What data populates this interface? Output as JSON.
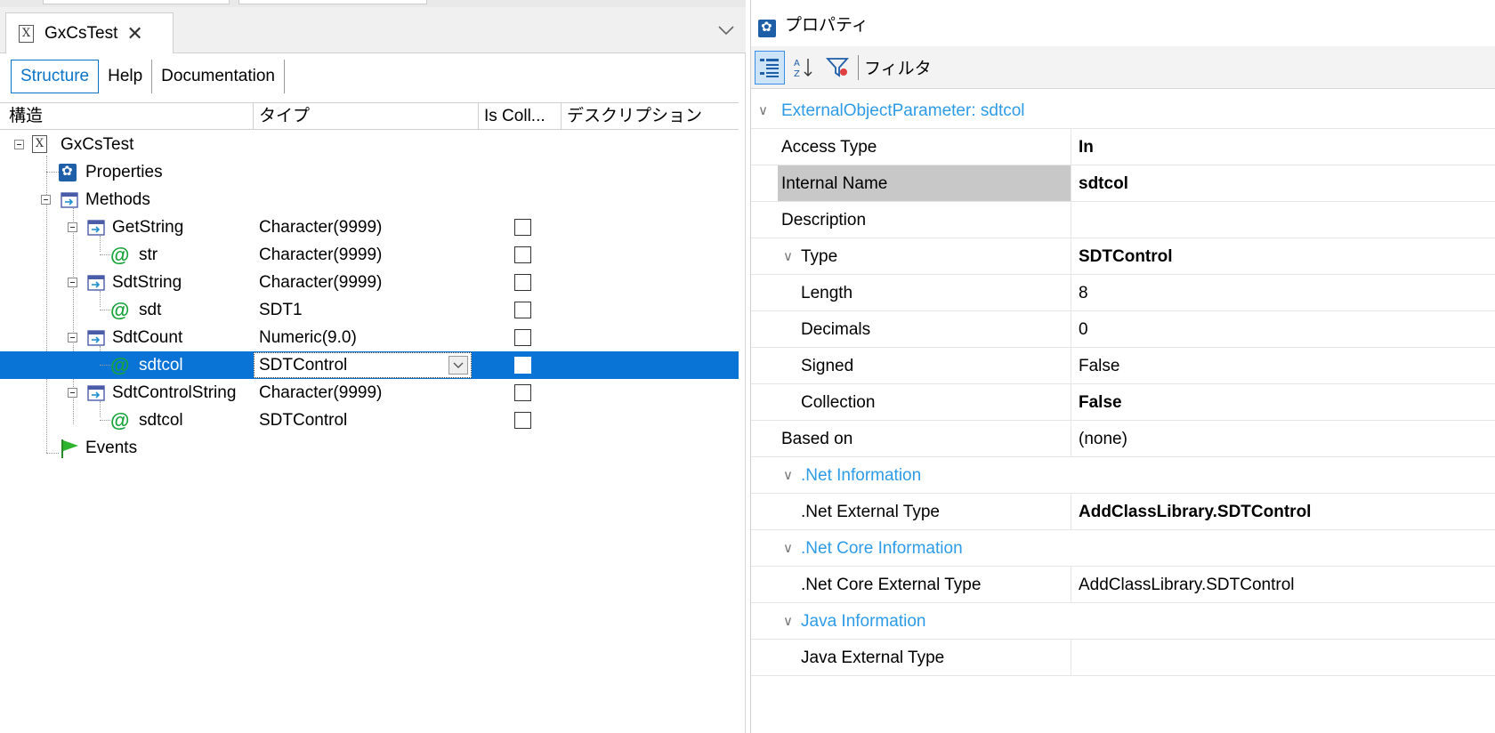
{
  "editor": {
    "tab_title": "GxCsTest",
    "subtabs": [
      "Structure",
      "Help",
      "Documentation"
    ],
    "columns": [
      "構造",
      "タイプ",
      "Is Coll...",
      "デスクリプション"
    ],
    "tree": [
      {
        "name": "GxCsTest",
        "type": "",
        "kind": "root",
        "level": 0
      },
      {
        "name": "Properties",
        "type": "",
        "kind": "properties",
        "level": 1
      },
      {
        "name": "Methods",
        "type": "",
        "kind": "methods",
        "level": 1
      },
      {
        "name": "GetString",
        "type": "Character(9999)",
        "kind": "method",
        "level": 2
      },
      {
        "name": "str",
        "type": "Character(9999)",
        "kind": "param",
        "level": 3
      },
      {
        "name": "SdtString",
        "type": "Character(9999)",
        "kind": "method",
        "level": 2
      },
      {
        "name": "sdt",
        "type": "SDT1",
        "kind": "param",
        "level": 3
      },
      {
        "name": "SdtCount",
        "type": "Numeric(9.0)",
        "kind": "method",
        "level": 2
      },
      {
        "name": "sdtcol",
        "type": "SDTControl",
        "kind": "param",
        "level": 3,
        "selected": true
      },
      {
        "name": "SdtControlString",
        "type": "Character(9999)",
        "kind": "method",
        "level": 2
      },
      {
        "name": "sdtcol",
        "type": "SDTControl",
        "kind": "param",
        "level": 3
      },
      {
        "name": "Events",
        "type": "",
        "kind": "events",
        "level": 1
      }
    ]
  },
  "properties": {
    "title": "プロパティ",
    "filter_label": "フィルタ",
    "rows": [
      {
        "name": "ExternalObjectParameter: sdtcol",
        "value": "",
        "kind": "header"
      },
      {
        "name": "Access Type",
        "value": "In",
        "bold": true,
        "indent": 0
      },
      {
        "name": "Internal Name",
        "value": "sdtcol",
        "bold": true,
        "indent": 0,
        "highlight": true
      },
      {
        "name": "Description",
        "value": "",
        "indent": 0
      },
      {
        "name": "Type",
        "value": "SDTControl",
        "bold": true,
        "indent": 0,
        "expander": true
      },
      {
        "name": "Length",
        "value": "8",
        "indent": 1
      },
      {
        "name": "Decimals",
        "value": "0",
        "indent": 1
      },
      {
        "name": "Signed",
        "value": "False",
        "indent": 1
      },
      {
        "name": "Collection",
        "value": "False",
        "bold": true,
        "indent": 1
      },
      {
        "name": "Based on",
        "value": "(none)",
        "indent": 0
      },
      {
        "name": ".Net Information",
        "value": "",
        "kind": "group"
      },
      {
        "name": ".Net External Type",
        "value": "AddClassLibrary.SDTControl",
        "bold": true,
        "indent": 1
      },
      {
        "name": ".Net Core Information",
        "value": "",
        "kind": "group"
      },
      {
        "name": ".Net Core External Type",
        "value": "AddClassLibrary.SDTControl",
        "indent": 1
      },
      {
        "name": "Java Information",
        "value": "",
        "kind": "group"
      },
      {
        "name": "Java External Type",
        "value": "",
        "indent": 1
      }
    ]
  }
}
